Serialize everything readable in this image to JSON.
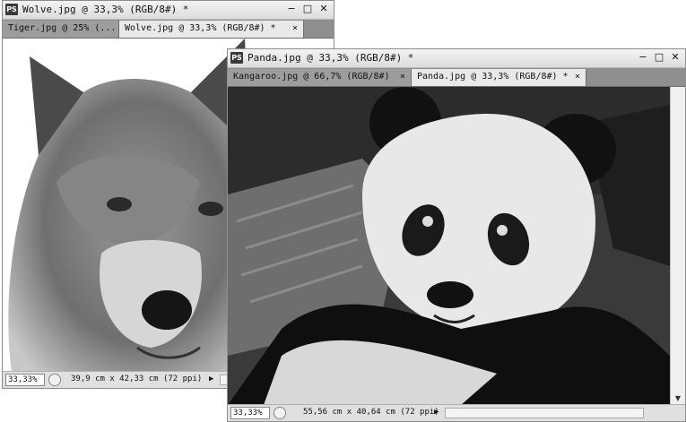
{
  "windows": {
    "wolf": {
      "app_icon": "PS",
      "title": "Wolve.jpg @ 33,3% (RGB/8#) *",
      "tabs": [
        {
          "label": "Tiger.jpg @ 25% (...",
          "active": false
        },
        {
          "label": "Wolve.jpg @ 33,3% (RGB/8#) *",
          "active": true
        }
      ],
      "status": {
        "zoom": "33,33%",
        "doc_size": "39,9 cm x 42,33 cm (72 ppi)"
      }
    },
    "panda": {
      "app_icon": "PS",
      "title": "Panda.jpg @ 33,3% (RGB/8#) *",
      "tabs": [
        {
          "label": "Kangaroo.jpg @ 66,7% (RGB/8#)",
          "active": false
        },
        {
          "label": "Panda.jpg @ 33,3% (RGB/8#) *",
          "active": true
        }
      ],
      "status": {
        "zoom": "33,33%",
        "doc_size": "55,56 cm x 40,64 cm (72 ppi)"
      }
    }
  },
  "glyphs": {
    "minimize": "−",
    "maximize": "□",
    "close": "✕",
    "tab_close": "×",
    "status_arrow": "▶"
  },
  "icons": [
    "ps-app-icon",
    "minimize-icon",
    "maximize-icon",
    "close-icon",
    "tab-close-icon",
    "status-menu-icon",
    "status-arrow-icon",
    "scroll-arrow-icon"
  ]
}
